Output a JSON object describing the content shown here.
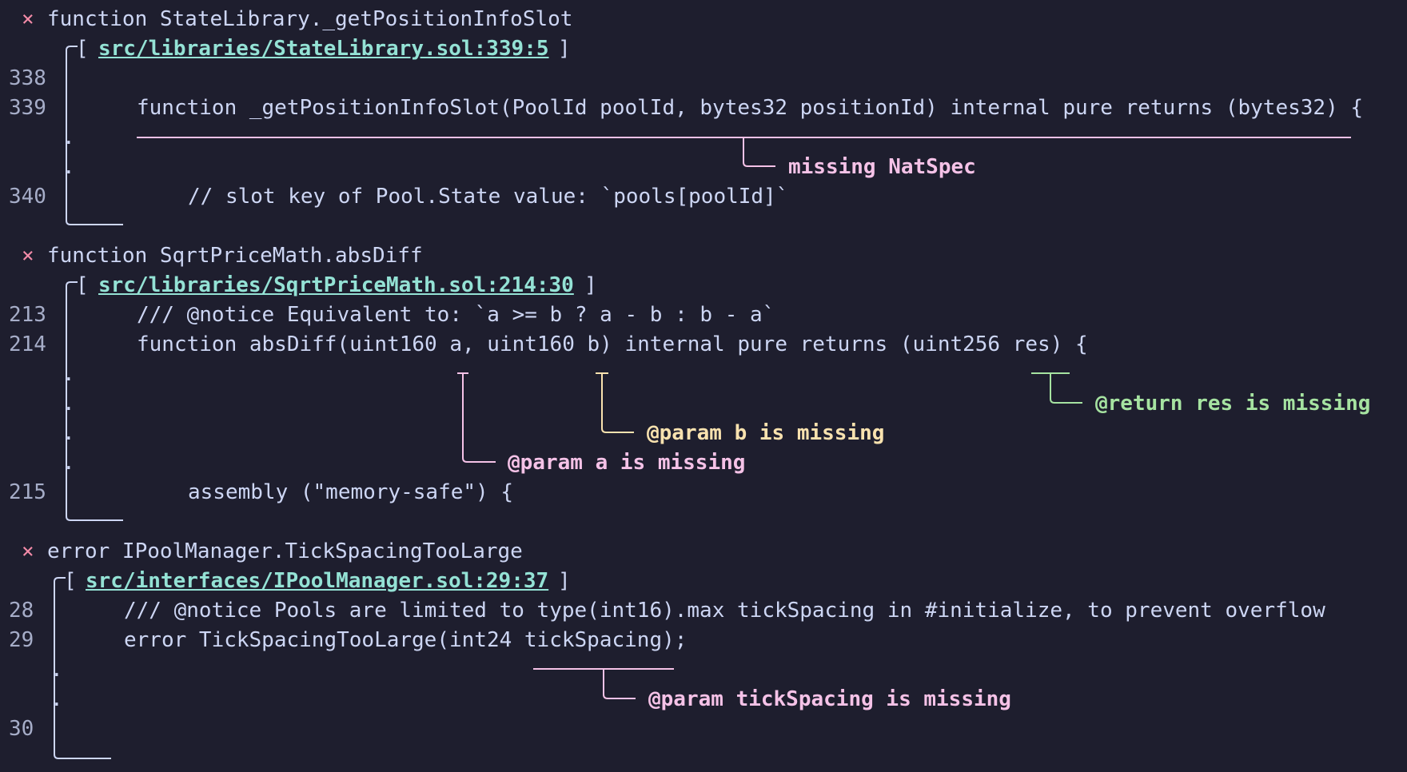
{
  "diagnostics": [
    {
      "cross": "×",
      "header": "function StateLibrary._getPositionInfoSlot",
      "location": "src/libraries/StateLibrary.sol:339:5",
      "lines": [
        {
          "num": "338",
          "code": ""
        },
        {
          "num": "339",
          "code": "function _getPositionInfoSlot(PoolId poolId, bytes32 positionId) internal pure returns (bytes32) {"
        },
        {
          "num": "340",
          "code": "// slot key of Pool.State value: `pools[poolId]`"
        }
      ],
      "labels": [
        {
          "text": "missing NatSpec",
          "color": "#f5c2e7"
        }
      ]
    },
    {
      "cross": "×",
      "header": "function SqrtPriceMath.absDiff",
      "location": "src/libraries/SqrtPriceMath.sol:214:30",
      "lines": [
        {
          "num": "213",
          "code": "/// @notice Equivalent to: `a >= b ? a - b : b - a`"
        },
        {
          "num": "214",
          "code": "function absDiff(uint160 a, uint160 b) internal pure returns (uint256 res) {"
        },
        {
          "num": "215",
          "code": "assembly (\"memory-safe\") {"
        }
      ],
      "labels": [
        {
          "text": "@return res is missing",
          "color": "#a6e3a1"
        },
        {
          "text": "@param b is missing",
          "color": "#f9e2af"
        },
        {
          "text": "@param a is missing",
          "color": "#f5c2e7"
        }
      ]
    },
    {
      "cross": "×",
      "header": "error IPoolManager.TickSpacingTooLarge",
      "location": "src/interfaces/IPoolManager.sol:29:37",
      "lines": [
        {
          "num": "28",
          "code": "/// @notice Pools are limited to type(int16).max tickSpacing in #initialize, to prevent overflow"
        },
        {
          "num": "29",
          "code": "error TickSpacingTooLarge(int24 tickSpacing);"
        },
        {
          "num": "30",
          "code": ""
        }
      ],
      "labels": [
        {
          "text": "@param tickSpacing is missing",
          "color": "#f5c2e7"
        }
      ]
    }
  ],
  "ui": {
    "open_bracket": "[",
    "close_bracket": "]",
    "gutter_dot": "."
  }
}
